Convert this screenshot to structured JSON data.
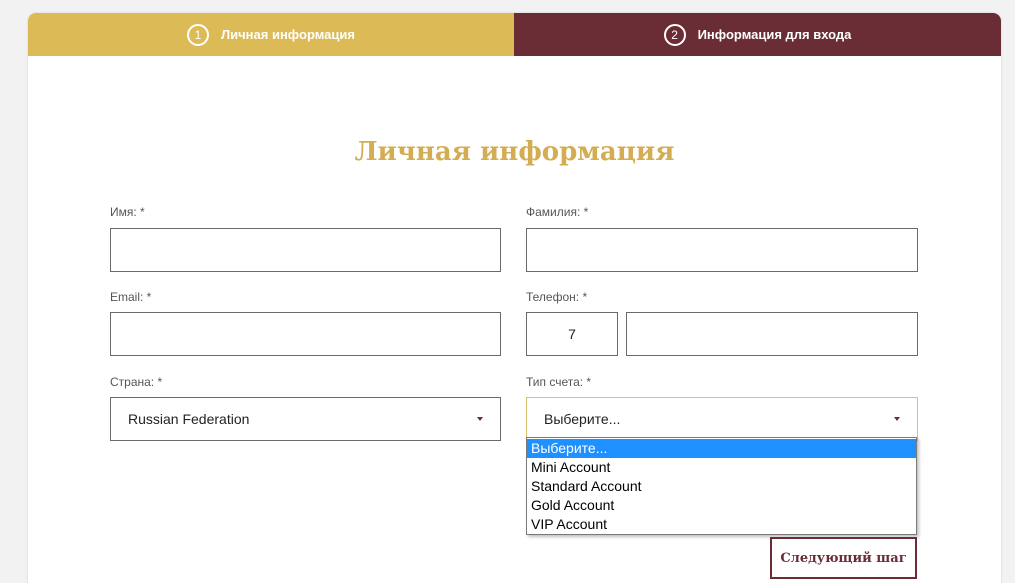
{
  "colors": {
    "gold": "#dcbb56",
    "maroon": "#6b2d35",
    "title_gold": "#d4ad53"
  },
  "steps": [
    {
      "number": "1",
      "label": "Личная информация"
    },
    {
      "number": "2",
      "label": "Информация для входа"
    }
  ],
  "form": {
    "title": "Личная информация",
    "first_name": {
      "label": "Имя: *",
      "value": ""
    },
    "last_name": {
      "label": "Фамилия: *",
      "value": ""
    },
    "email": {
      "label": "Email: *",
      "value": ""
    },
    "phone": {
      "label": "Телефон: *",
      "code": "7",
      "value": ""
    },
    "country": {
      "label": "Страна: *",
      "value": "Russian Federation"
    },
    "account_type": {
      "label": "Тип счета: *",
      "value": "Выберите...",
      "options": [
        "Выберите...",
        "Mini Account",
        "Standard Account",
        "Gold Account",
        "VIP Account"
      ]
    },
    "next_label": "Следующий шаг"
  }
}
